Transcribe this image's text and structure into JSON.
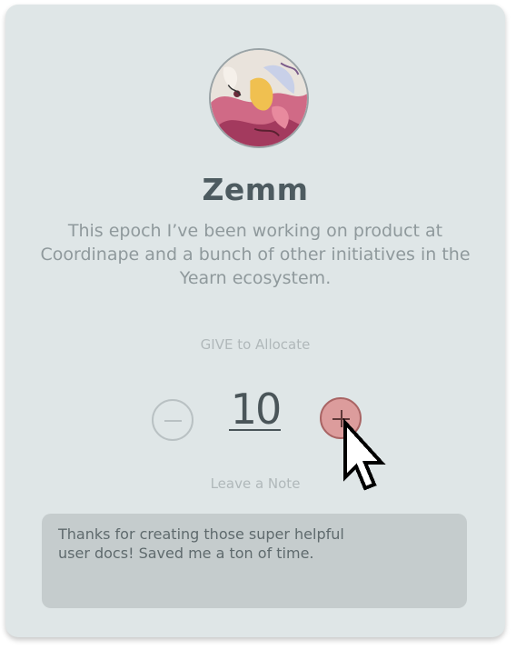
{
  "profile": {
    "name": "Zemm",
    "bio": "This epoch I’ve been working on product at Coordinape and a bunch of other initiatives in the Yearn ecosystem."
  },
  "allocation": {
    "label": "GIVE to Allocate",
    "value": "10",
    "decrement_icon": "minus-icon",
    "increment_icon": "plus-icon"
  },
  "note": {
    "label": "Leave a Note",
    "text": "Thanks for creating those super helpful\nuser docs! Saved me a ton of time."
  },
  "colors": {
    "card_bg": "#dfe6e7",
    "accent_plus": "#dc9c9c",
    "text_dark": "#4d5b60"
  },
  "cursor_icon": "pointer-cursor-icon"
}
